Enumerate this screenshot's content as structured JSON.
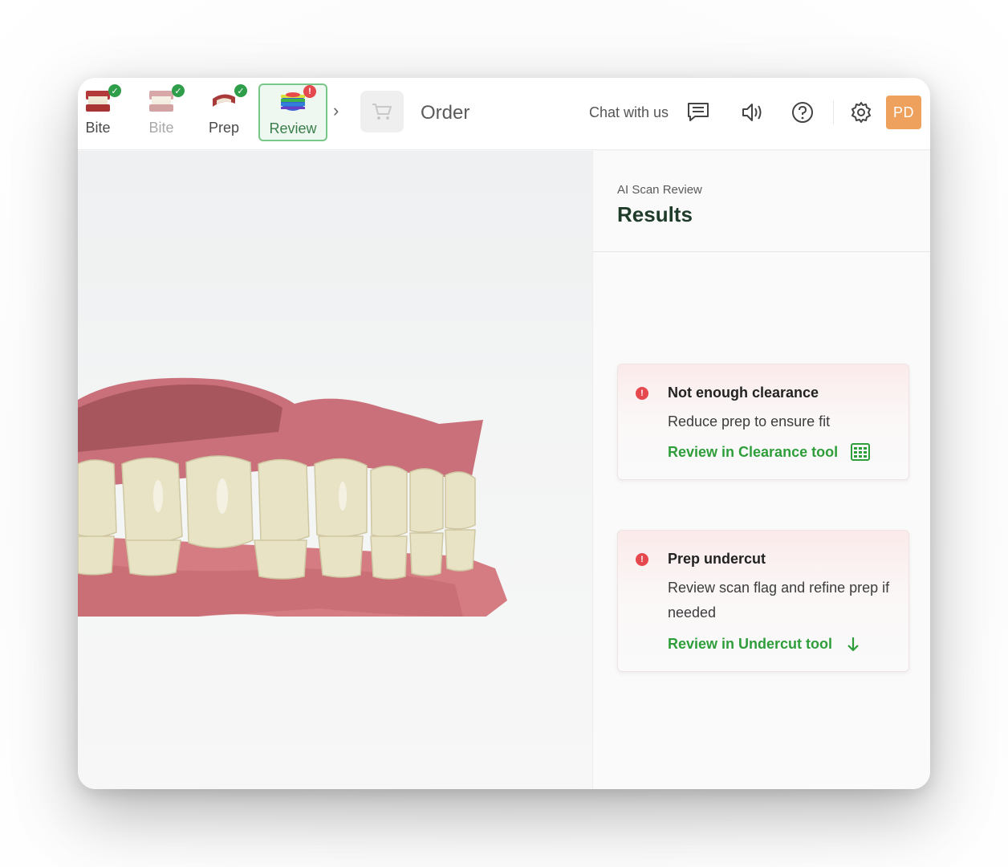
{
  "steps": [
    {
      "label": "Bite",
      "status": "done",
      "icon": "bite-scan-thumbnail"
    },
    {
      "label": "Bite",
      "status": "done",
      "icon": "bite-scan-thumbnail"
    },
    {
      "label": "Prep",
      "status": "done",
      "icon": "prep-scan-thumbnail"
    },
    {
      "label": "Review",
      "status": "error",
      "icon": "review-heatmap-thumbnail"
    }
  ],
  "header": {
    "order_label": "Order",
    "chat_label": "Chat with us",
    "avatar_initials": "PD"
  },
  "panel": {
    "subtitle": "AI Scan Review",
    "title": "Results"
  },
  "results": [
    {
      "title": "Not enough clearance",
      "text": "Reduce prep to ensure fit",
      "link": "Review in Clearance tool",
      "link_icon": "clearance-map-icon"
    },
    {
      "title": "Prep undercut",
      "text": "Review scan flag and refine prep if needed",
      "link": "Review in Undercut tool",
      "link_icon": "arrow-down-icon"
    }
  ],
  "colors": {
    "success": "#2e9e4a",
    "error": "#e5484d",
    "accent_link": "#2e9e3a",
    "avatar_bg": "#eda15c"
  }
}
